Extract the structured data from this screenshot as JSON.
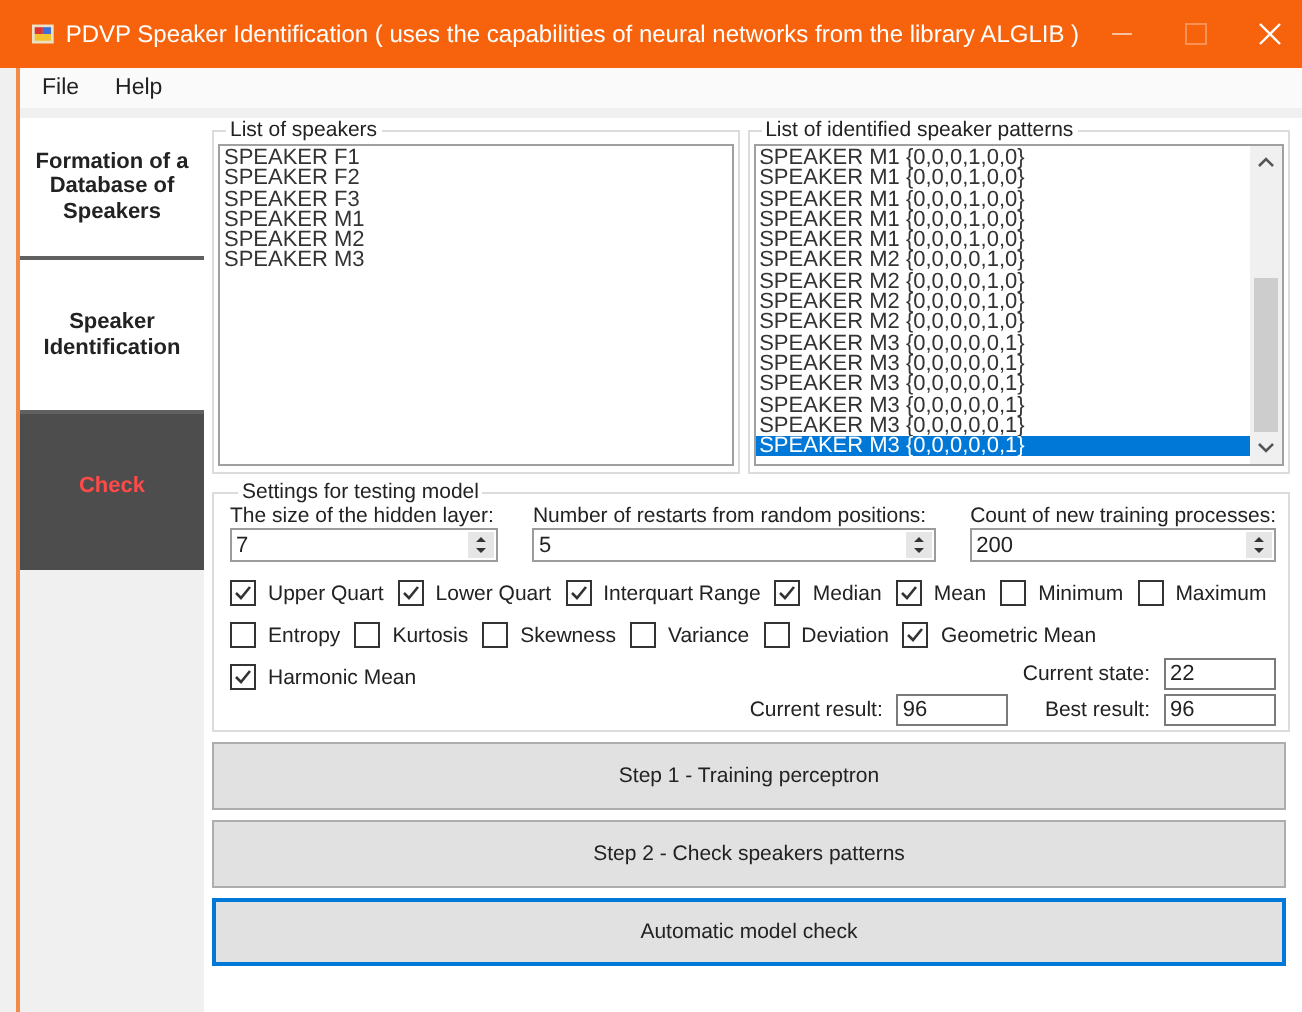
{
  "window": {
    "title": "PDVP Speaker Identification ( uses the capabilities of neural networks from the library ALGLIB )"
  },
  "menu": [
    "File",
    "Help"
  ],
  "sidebar": {
    "items": [
      {
        "label": "Formation of a Database of Speakers",
        "selected": false
      },
      {
        "label": "Speaker Identification",
        "selected": false
      },
      {
        "label": "Check",
        "selected": true
      }
    ]
  },
  "speakers": {
    "title": "List of speakers",
    "items": [
      "SPEAKER F1",
      "SPEAKER F2",
      "SPEAKER F3",
      "SPEAKER M1",
      "SPEAKER M2",
      "SPEAKER M3"
    ]
  },
  "patterns": {
    "title": "List of identified speaker patterns",
    "items": [
      {
        "text": "SPEAKER M1 {0,0,0,1,0,0}",
        "selected": false
      },
      {
        "text": "SPEAKER M1 {0,0,0,1,0,0}",
        "selected": false
      },
      {
        "text": "SPEAKER M1 {0,0,0,1,0,0}",
        "selected": false
      },
      {
        "text": "SPEAKER M1 {0,0,0,1,0,0}",
        "selected": false
      },
      {
        "text": "SPEAKER M1 {0,0,0,1,0,0}",
        "selected": false
      },
      {
        "text": "SPEAKER M2 {0,0,0,0,1,0}",
        "selected": false
      },
      {
        "text": "SPEAKER M2 {0,0,0,0,1,0}",
        "selected": false
      },
      {
        "text": "SPEAKER M2 {0,0,0,0,1,0}",
        "selected": false
      },
      {
        "text": "SPEAKER M2 {0,0,0,0,1,0}",
        "selected": false
      },
      {
        "text": "SPEAKER M3 {0,0,0,0,0,1}",
        "selected": false
      },
      {
        "text": "SPEAKER M3 {0,0,0,0,0,1}",
        "selected": false
      },
      {
        "text": "SPEAKER M3 {0,0,0,0,0,1}",
        "selected": false
      },
      {
        "text": "SPEAKER M3 {0,0,0,0,0,1}",
        "selected": false
      },
      {
        "text": "SPEAKER M3 {0,0,0,0,0,1}",
        "selected": false
      },
      {
        "text": "SPEAKER M3 {0,0,0,0,0,1}",
        "selected": true
      }
    ]
  },
  "settings": {
    "title": "Settings for testing model",
    "spinners": [
      {
        "label": "The size of the hidden layer:",
        "value": "7"
      },
      {
        "label": "Number of restarts from random positions:",
        "value": "5"
      },
      {
        "label": "Count of new training processes:",
        "value": "200"
      }
    ],
    "metric_rows": [
      [
        {
          "label": "Upper Quart",
          "checked": true
        },
        {
          "label": "Lower Quart",
          "checked": true
        },
        {
          "label": "Interquart Range",
          "checked": true
        },
        {
          "label": "Median",
          "checked": true
        },
        {
          "label": "Mean",
          "checked": true
        },
        {
          "label": "Minimum",
          "checked": false
        },
        {
          "label": "Maximum",
          "checked": false
        }
      ],
      [
        {
          "label": "Entropy",
          "checked": false
        },
        {
          "label": "Kurtosis",
          "checked": false
        },
        {
          "label": "Skewness",
          "checked": false
        },
        {
          "label": "Variance",
          "checked": false
        },
        {
          "label": "Deviation",
          "checked": false
        },
        {
          "label": "Geometric Mean",
          "checked": true
        }
      ],
      [
        {
          "label": "Harmonic Mean",
          "checked": true
        }
      ]
    ],
    "current_state": {
      "label": "Current state:",
      "value": "22"
    },
    "current_result": {
      "label": "Current result:",
      "value": "96"
    },
    "best_result": {
      "label": "Best result:",
      "value": "96"
    }
  },
  "buttons": [
    {
      "label": "Step 1 - Training perceptron",
      "focused": false
    },
    {
      "label": "Step 2 - Check speakers patterns",
      "focused": false
    },
    {
      "label": "Automatic model check",
      "focused": true
    }
  ]
}
